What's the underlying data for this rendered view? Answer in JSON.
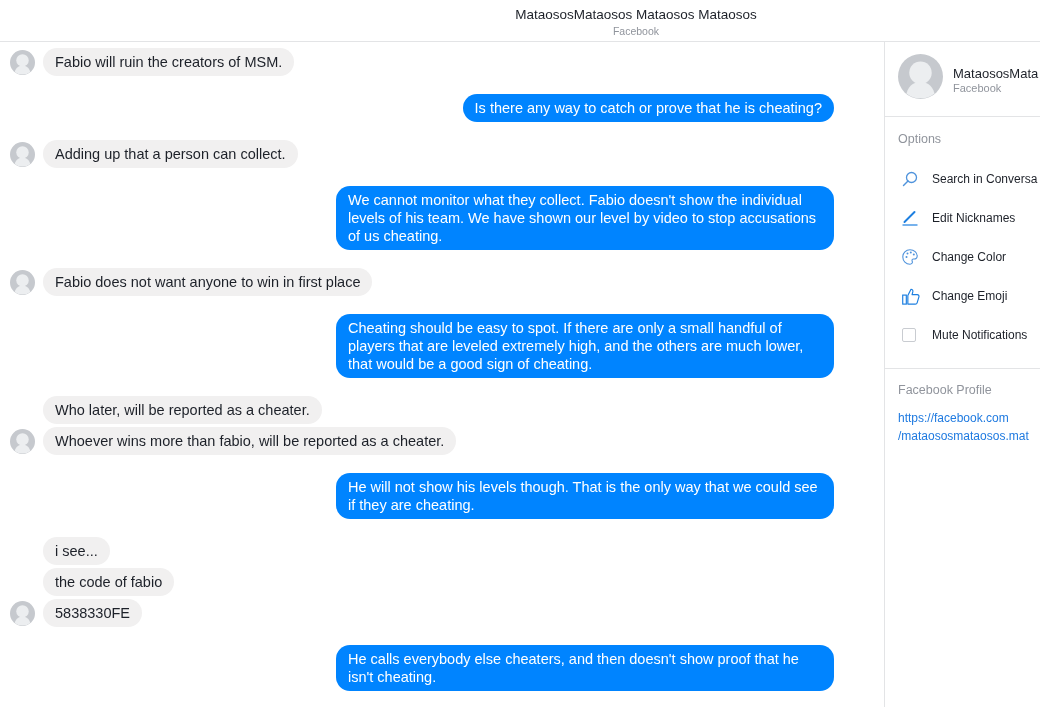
{
  "header": {
    "title": "MataososMataosos Mataosos Mataosos",
    "subtitle": "Facebook"
  },
  "conversation": [
    {
      "kind": "incoming",
      "messages": [
        "Fabio will ruin the creators of MSM."
      ]
    },
    {
      "kind": "outgoing",
      "messages": [
        "Is there any way to catch or prove that he is cheating?"
      ]
    },
    {
      "kind": "incoming",
      "messages": [
        "Adding up that a person can collect."
      ]
    },
    {
      "kind": "outgoing",
      "messages": [
        "We cannot monitor what they collect. Fabio doesn't show the individual levels of his team. We have shown our level by video to stop accusations of us cheating."
      ]
    },
    {
      "kind": "incoming",
      "messages": [
        "Fabio does not want anyone to win in first place"
      ]
    },
    {
      "kind": "outgoing",
      "messages": [
        "Cheating should be easy to spot. If there are only a small handful of players that are leveled extremely high, and the others are much lower, that would be a good sign of cheating."
      ]
    },
    {
      "kind": "incoming",
      "messages": [
        "Who later, will be reported as a cheater.",
        "Whoever wins more than fabio, will be reported as a cheater."
      ]
    },
    {
      "kind": "outgoing",
      "messages": [
        "He will not show his levels though. That is the only way that we could see if they are cheating."
      ]
    },
    {
      "kind": "incoming",
      "messages": [
        "i see...",
        "the code of fabio",
        "5838330FE"
      ]
    },
    {
      "kind": "outgoing",
      "messages": [
        "He calls everybody else cheaters, and then doesn't show proof that he isn't cheating."
      ]
    }
  ],
  "details_panel": {
    "contact": {
      "name": "MataososMata",
      "subtitle": "Facebook"
    },
    "options_heading": "Options",
    "options": [
      {
        "label": "Search in Conversa"
      },
      {
        "label": "Edit Nicknames"
      },
      {
        "label": "Change Color"
      },
      {
        "label": "Change Emoji"
      }
    ],
    "mute_notifications": {
      "label": "Mute Notifications",
      "checked": false
    },
    "profile_heading": "Facebook Profile",
    "profile_link": "https://facebook.com\n/mataososmataosos.mat"
  }
}
